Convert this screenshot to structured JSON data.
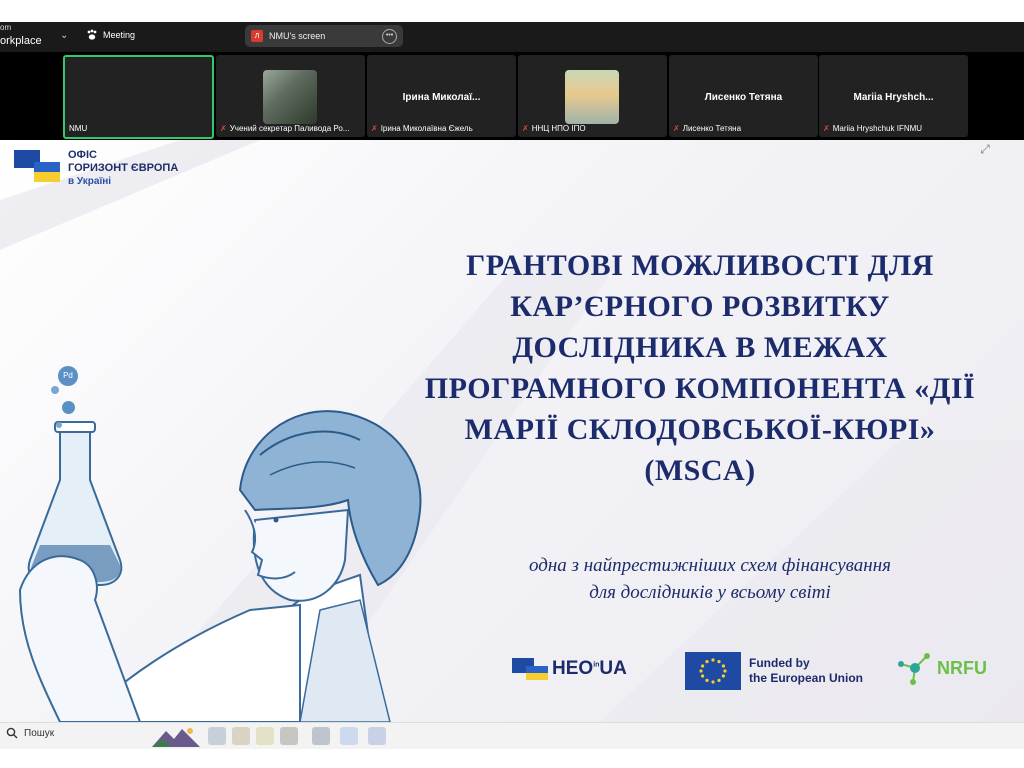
{
  "zoom_bar": {
    "brand_line1": "om",
    "brand_line2": "orkplace",
    "meeting_label": "Meeting",
    "screen_pill": {
      "badge": "Л",
      "label": "NMU's screen"
    }
  },
  "participants": [
    {
      "label": "NMU",
      "show_name": "",
      "muted": false,
      "has_photo": false,
      "active": true
    },
    {
      "label": "Учений секретар Паливода Ро...",
      "show_name": "",
      "muted": true,
      "has_photo": true,
      "active": false
    },
    {
      "label": "Ірина Миколаївна Єжель",
      "show_name": "Ірина  Миколаї...",
      "muted": true,
      "has_photo": false,
      "active": false
    },
    {
      "label": "ННЦ НПО ІПО",
      "show_name": "",
      "muted": true,
      "has_photo": true,
      "active": false
    },
    {
      "label": "Лисенко Тетяна",
      "show_name": "Лисенко Тетяна",
      "muted": true,
      "has_photo": false,
      "active": false
    },
    {
      "label": "Mariia Hryshchuk IFNMU",
      "show_name": "Mariia  Hryshch...",
      "muted": true,
      "has_photo": false,
      "active": false
    }
  ],
  "slide": {
    "office_logo": {
      "line1": "ОФІС",
      "line2": "ГОРИЗОНТ ЄВРОПА",
      "line3": "в Україні"
    },
    "title_lines": [
      "ГРАНТОВІ МОЖЛИВОСТІ ДЛЯ",
      "КАР’ЄРНОГО РОЗВИТКУ",
      "ДОСЛІДНИКА В МЕЖАХ",
      "ПРОГРАМНОГО КОМПОНЕНТА «ДІЇ",
      "МАРІЇ СКЛОДОВСЬКОЇ-КЮРІ»",
      "(MSCA)"
    ],
    "subtitle_lines": [
      "одна з найпрестижніших схем фінансування",
      "для дослідників у всьому світі"
    ],
    "bubble_label": "Pd",
    "partners": {
      "heo_text": "HEO",
      "heo_ua": "UA",
      "heo_small": "in",
      "eu_line1": "Funded by",
      "eu_line2": "the European Union",
      "nrfu_text": "NRFU"
    }
  },
  "taskbar": {
    "search_label": "Пошук"
  },
  "colors": {
    "navy": "#1c2b6b",
    "eu_blue": "#1f4aa3",
    "ua_yellow": "#f6cf2e",
    "nrfu_green": "#6cc04a",
    "active_green": "#33c86a"
  }
}
